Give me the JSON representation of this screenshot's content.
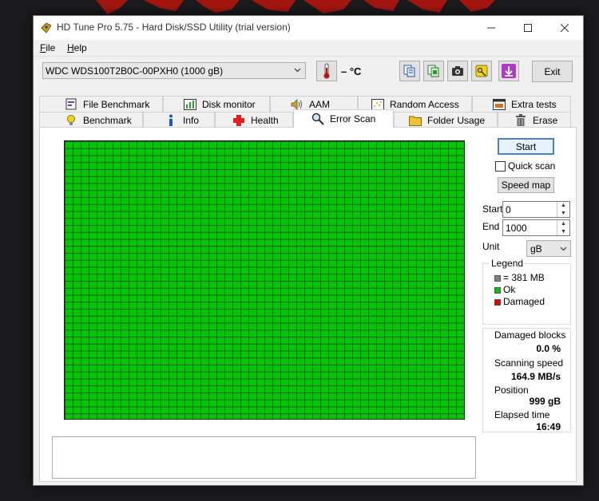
{
  "window": {
    "title": "HD Tune Pro 5.75 - Hard Disk/SSD Utility (trial version)"
  },
  "menu": [
    {
      "label": "File",
      "ul": "F",
      "rest": "ile"
    },
    {
      "label": "Help",
      "ul": "H",
      "rest": "elp"
    }
  ],
  "toolbar": {
    "drive": "WDC WDS100T2B0C-00PXH0 (1000 gB)",
    "temperature": "– °C",
    "exit_label": "Exit",
    "icons": [
      "copy-text-icon",
      "copy-screenshot-icon",
      "camera-icon",
      "options-icon",
      "save-download-icon"
    ]
  },
  "tabs": {
    "row1": [
      {
        "label": "File Benchmark",
        "icon": "file-benchmark-icon"
      },
      {
        "label": "Disk monitor",
        "icon": "disk-monitor-icon"
      },
      {
        "label": "AAM",
        "icon": "speaker-icon"
      },
      {
        "label": "Random Access",
        "icon": "random-access-icon"
      },
      {
        "label": "Extra tests",
        "icon": "extra-tests-icon"
      }
    ],
    "row2": [
      {
        "label": "Benchmark",
        "icon": "lightbulb-icon"
      },
      {
        "label": "Info",
        "icon": "info-icon"
      },
      {
        "label": "Health",
        "icon": "health-cross-icon"
      },
      {
        "label": "Error Scan",
        "icon": "magnifier-icon",
        "active": true
      },
      {
        "label": "Folder Usage",
        "icon": "folder-icon"
      },
      {
        "label": "Erase",
        "icon": "trash-icon"
      }
    ]
  },
  "controls": {
    "start_button": "Start",
    "quick_scan_label": "Quick scan",
    "quick_scan_checked": false,
    "speed_map_button": "Speed map",
    "start_label": "Start",
    "start_value": "0",
    "end_label": "End",
    "end_value": "1000",
    "unit_label": "Unit",
    "unit_value": "gB"
  },
  "legend": {
    "title": "Legend",
    "items": [
      {
        "label": "= 381 MB",
        "color": "#808080"
      },
      {
        "label": "Ok",
        "color": "#00c800"
      },
      {
        "label": "Damaged",
        "color": "#e00000"
      }
    ]
  },
  "stats": {
    "damaged_blocks_label": "Damaged blocks",
    "damaged_blocks_value": "0.0 %",
    "scanning_speed_label": "Scanning speed",
    "scanning_speed_value": "164.9 MB/s",
    "position_label": "Position",
    "position_value": "999 gB",
    "elapsed_label": "Elapsed time",
    "elapsed_value": "16:49"
  },
  "scan_grid": {
    "status": "ok",
    "ok_color": "#00c800",
    "line_color": "#1b5e1b"
  },
  "colors": {
    "accent": "#4a7fc1",
    "background": "#1b1b1e"
  }
}
